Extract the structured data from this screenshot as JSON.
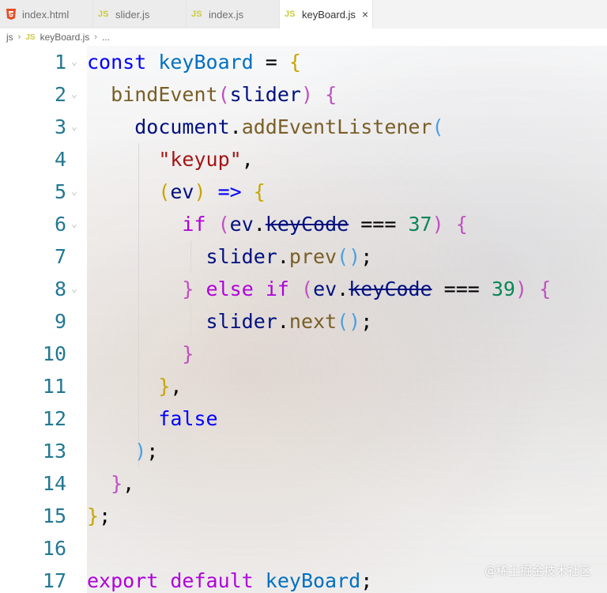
{
  "tabs": [
    {
      "label": "index.html",
      "icon": "html5-icon",
      "active": false
    },
    {
      "label": "slider.js",
      "icon": "js-icon",
      "active": false
    },
    {
      "label": "index.js",
      "icon": "js-icon",
      "active": false
    },
    {
      "label": "keyBoard.js",
      "icon": "js-icon",
      "active": true
    }
  ],
  "tab_icon_text": "JS",
  "close_glyph": "×",
  "breadcrumb": {
    "folder": "js",
    "file_icon": "JS",
    "file": "keyBoard.js",
    "ellipsis": "..."
  },
  "code": {
    "line_numbers": [
      "1",
      "2",
      "3",
      "4",
      "5",
      "6",
      "7",
      "8",
      "9",
      "10",
      "11",
      "12",
      "13",
      "14",
      "15",
      "16",
      "17"
    ],
    "folding_lines": [
      "1",
      "2",
      "3",
      "5",
      "6",
      "8"
    ]
  },
  "watermark": "@稀土掘金技术社区",
  "colors": {
    "keyword": "#0000ff",
    "control": "#af00db",
    "identifier": "#001080",
    "function": "#795e26",
    "string": "#a31515",
    "number": "#098658",
    "line_number": "#237893"
  }
}
